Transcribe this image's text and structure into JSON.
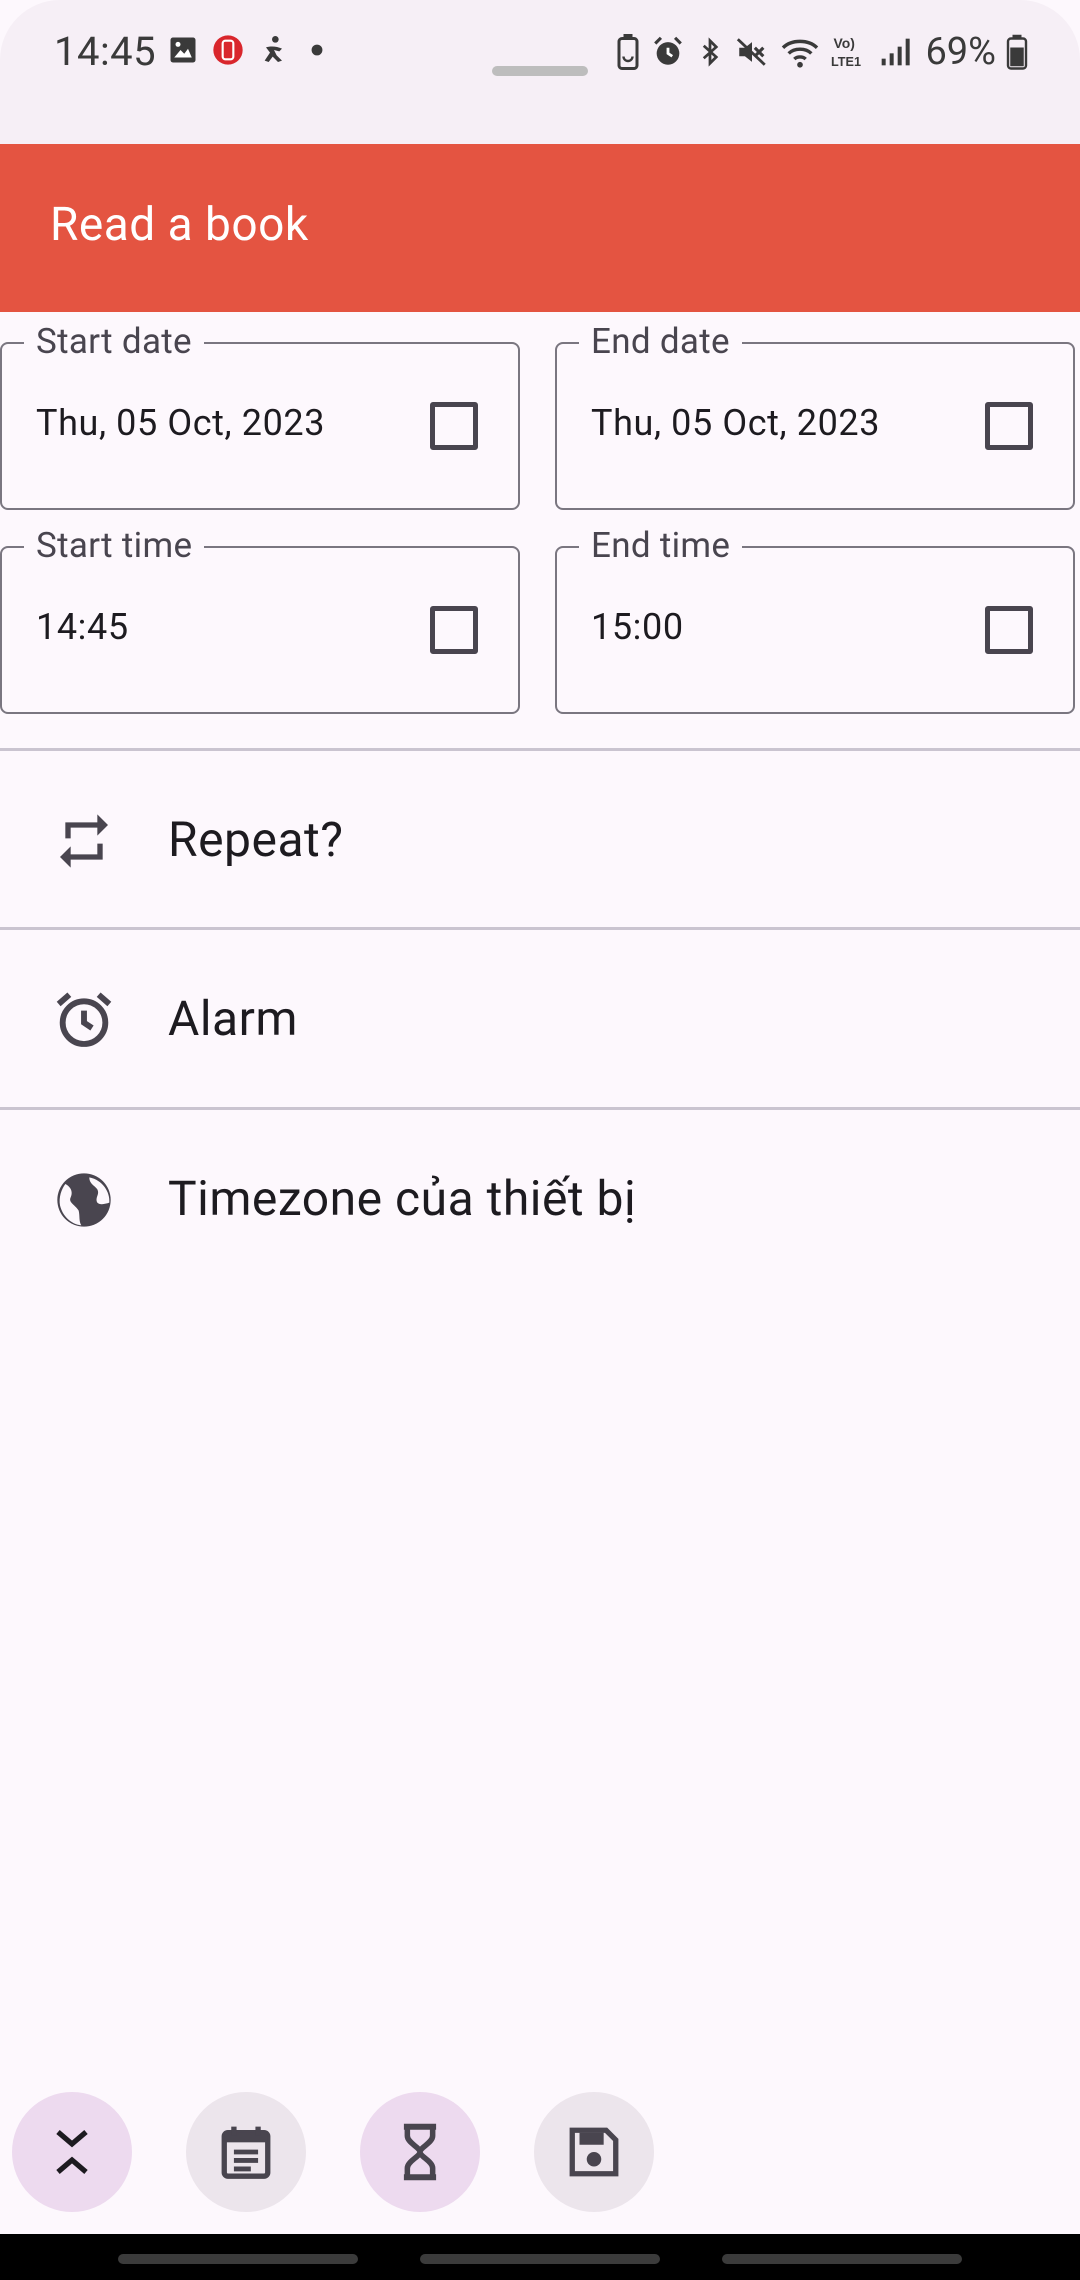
{
  "status_bar": {
    "time": "14:45",
    "battery": "69%",
    "left_icons": [
      "image-icon",
      "app-notification-icon",
      "accessibility-icon",
      "dot-icon"
    ],
    "right_icons": [
      "battery-saver-icon",
      "alarm-icon",
      "bluetooth-icon",
      "mute-icon",
      "wifi-icon",
      "volte-icon",
      "signal-icon",
      "battery-icon"
    ],
    "volte_label": "Vo)",
    "lte_label": "LTE1"
  },
  "app_bar": {
    "title": "Read a book",
    "color": "#e45441"
  },
  "fields": {
    "start_date": {
      "label": "Start date",
      "value": "Thu, 05 Oct, 2023"
    },
    "end_date": {
      "label": "End date",
      "value": "Thu, 05 Oct, 2023"
    },
    "start_time": {
      "label": "Start time",
      "value": "14:45"
    },
    "end_time": {
      "label": "End time",
      "value": "15:00"
    }
  },
  "list": {
    "repeat": {
      "label": "Repeat?",
      "icon": "repeat-icon"
    },
    "alarm": {
      "label": "Alarm",
      "icon": "alarm-clock-icon"
    },
    "timezone": {
      "label": "Timezone của thiết bị",
      "icon": "globe-icon"
    }
  },
  "bottom_actions": [
    {
      "icon": "collapse-icon",
      "bg": "#eddaef"
    },
    {
      "icon": "calendar-icon",
      "bg": "#ece5ec"
    },
    {
      "icon": "hourglass-icon",
      "bg": "#eddaef"
    },
    {
      "icon": "save-icon",
      "bg": "#ece5ec"
    }
  ]
}
